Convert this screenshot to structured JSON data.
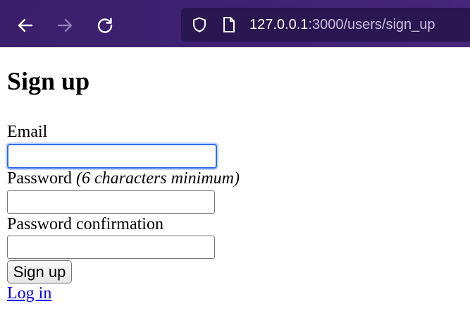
{
  "browser": {
    "url_host": "127.0.0.1",
    "url_rest": ":3000/users/sign_up",
    "icons": {
      "back": "arrow-left-icon",
      "forward": "arrow-right-icon",
      "reload": "reload-icon",
      "security": "shield-icon",
      "page": "page-icon"
    },
    "colors": {
      "toolbar": "#3f2272",
      "urlbar": "#2a1650"
    }
  },
  "page": {
    "title": "Sign up",
    "email_label": "Email",
    "password_label": "Password",
    "password_hint": "(6 characters minimum)",
    "confirm_label": "Password confirmation",
    "email_value": "",
    "password_value": "",
    "confirm_value": "",
    "submit_label": "Sign up",
    "login_link": "Log in",
    "colors": {
      "link": "#0000ee",
      "focus_ring": "#2f6ee8"
    }
  }
}
